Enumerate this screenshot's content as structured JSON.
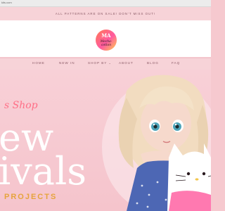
{
  "browser": {
    "url": "kits.com"
  },
  "announcement": {
    "text": "ALL PATTERNS ARE ON SALE! DON'T MISS OUT!"
  },
  "brand": {
    "mark": "MA",
    "name": "Mecha-cotton"
  },
  "nav": {
    "items": [
      {
        "label": "HOME"
      },
      {
        "label": "NEW IN"
      },
      {
        "label": "SHOP BY"
      },
      {
        "label": "ABOUT"
      },
      {
        "label": "BLOG"
      },
      {
        "label": "FAQ"
      }
    ]
  },
  "hero": {
    "script": "s Shop",
    "big_line1": "ew",
    "big_line2": "ivals",
    "subtitle": "PROJECTS"
  },
  "colors": {
    "accent": "#ff6e86",
    "hero_bg": "#f6c9cf",
    "subtitle": "#e6a43c",
    "nav_text": "#8a5a66"
  }
}
